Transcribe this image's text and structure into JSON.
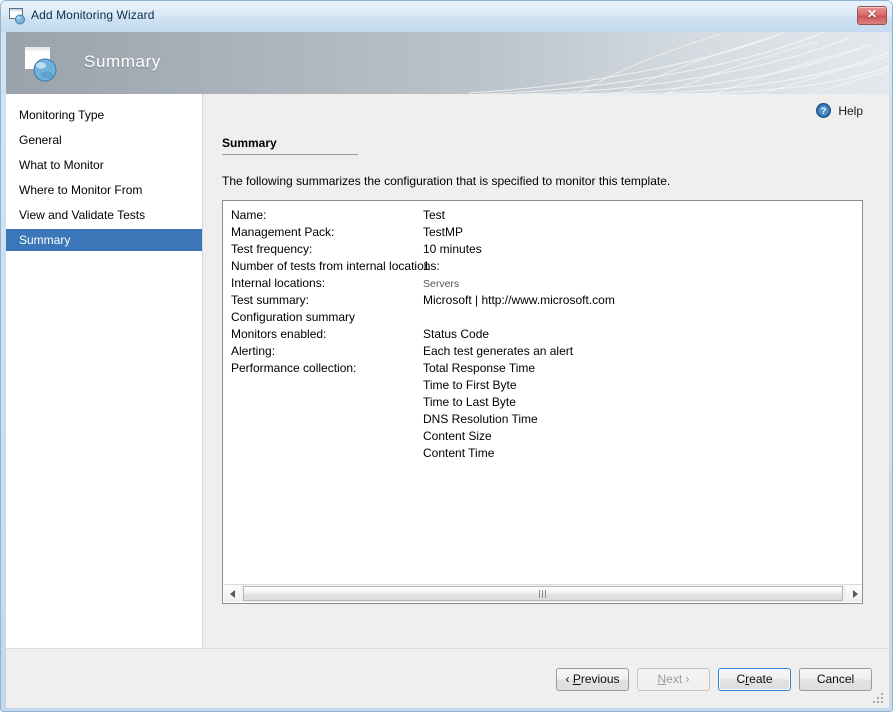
{
  "window": {
    "title": "Add Monitoring Wizard",
    "title_icon": "wizard-window-icon",
    "close_label": "✕"
  },
  "banner": {
    "title": "Summary",
    "icon": "page-globe-icon"
  },
  "sidebar": {
    "items": [
      {
        "label": "Monitoring Type",
        "selected": false
      },
      {
        "label": "General",
        "selected": false
      },
      {
        "label": "What to Monitor",
        "selected": false
      },
      {
        "label": "Where to Monitor From",
        "selected": false
      },
      {
        "label": "View and Validate Tests",
        "selected": false
      },
      {
        "label": "Summary",
        "selected": true
      }
    ],
    "selected_color": "#3a76b8"
  },
  "content": {
    "help_label": "Help",
    "help_icon": "help-question-icon",
    "section_title": "Summary",
    "intro_text": "The following summarizes the configuration that is specified to monitor this template.",
    "summary_rows": [
      {
        "label": "Name:",
        "value": "Test",
        "muted": false
      },
      {
        "label": "Management Pack:",
        "value": "TestMP",
        "muted": false
      },
      {
        "label": "Test frequency:",
        "value": "10 minutes",
        "muted": false
      },
      {
        "label": "Number of tests from internal locations:",
        "value": "1",
        "muted": false
      },
      {
        "label": "Internal locations:",
        "value": "Servers",
        "muted": true
      },
      {
        "label": "Test summary:",
        "value": "Microsoft | http://www.microsoft.com",
        "muted": false
      },
      {
        "label": "Configuration summary",
        "value": "",
        "muted": false
      },
      {
        "label": "Monitors enabled:",
        "value": "Status Code",
        "muted": false
      },
      {
        "label": "Alerting:",
        "value": "Each test generates an alert",
        "muted": false
      },
      {
        "label": "Performance collection:",
        "value": "Total Response Time",
        "muted": false
      },
      {
        "label": "",
        "value": "Time to First Byte",
        "muted": false
      },
      {
        "label": "",
        "value": "Time to Last Byte",
        "muted": false
      },
      {
        "label": "",
        "value": "DNS Resolution Time",
        "muted": false
      },
      {
        "label": "",
        "value": "Content Size",
        "muted": false
      },
      {
        "label": "",
        "value": "Content Time",
        "muted": false
      }
    ],
    "scrollbar": {
      "left_arrow": "scroll-left-arrow-icon",
      "right_arrow": "scroll-right-arrow-icon"
    }
  },
  "footer": {
    "buttons": [
      {
        "id": "previous",
        "prefix": "‹ ",
        "accel": "P",
        "rest": "revious",
        "suffix": "",
        "state": "enabled"
      },
      {
        "id": "next",
        "prefix": "",
        "accel": "N",
        "rest": "ext",
        "suffix": " ›",
        "state": "disabled"
      },
      {
        "id": "create",
        "prefix": "C",
        "accel": "r",
        "rest": "eate",
        "suffix": "",
        "state": "default"
      },
      {
        "id": "cancel",
        "prefix": "Cancel",
        "accel": "",
        "rest": "",
        "suffix": "",
        "state": "enabled"
      }
    ]
  }
}
